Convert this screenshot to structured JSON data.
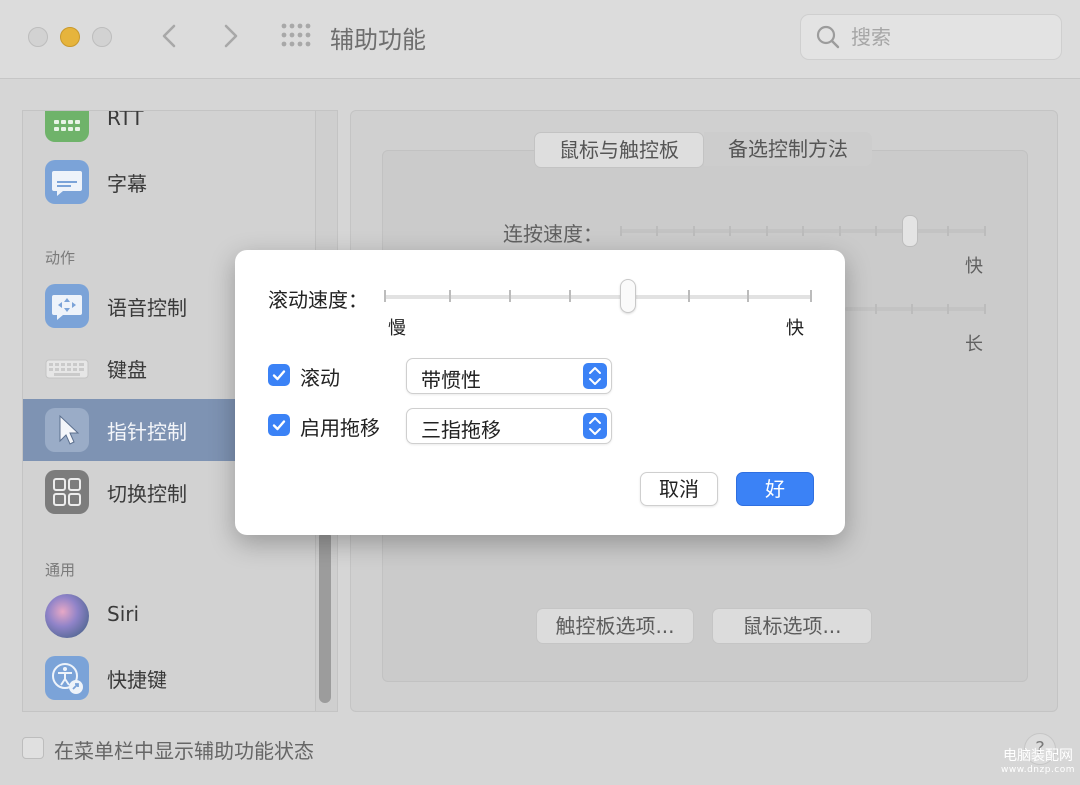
{
  "window": {
    "title": "辅助功能"
  },
  "search": {
    "placeholder": "搜索"
  },
  "sidebar": {
    "items": [
      {
        "label": "RTT",
        "icon": "keyboard-icon"
      },
      {
        "label": "字幕",
        "icon": "captions-icon"
      },
      {
        "label": "语音控制",
        "icon": "voice-control-icon"
      },
      {
        "label": "键盘",
        "icon": "keyboard-icon"
      },
      {
        "label": "指针控制",
        "icon": "pointer-icon"
      },
      {
        "label": "切换控制",
        "icon": "switch-control-icon"
      },
      {
        "label": "Siri",
        "icon": "siri-icon"
      },
      {
        "label": "快捷键",
        "icon": "accessibility-shortcut-icon"
      }
    ],
    "sections": {
      "actions": "动作",
      "general": "通用"
    },
    "selected": "指针控制"
  },
  "main": {
    "tabs": [
      {
        "label": "鼠标与触控板"
      },
      {
        "label": "备选控制方法"
      }
    ],
    "double_click_label": "连按速度：",
    "fast_label": "快",
    "long_label": "长",
    "trackpad_options": "触控板选项...",
    "mouse_options": "鼠标选项..."
  },
  "footer": {
    "show_status": "在菜单栏中显示辅助功能状态",
    "help": "?"
  },
  "dialog": {
    "scroll_speed_label": "滚动速度：",
    "scroll_speed_value": 0.57,
    "slow_label": "慢",
    "fast_label": "快",
    "scrolling": {
      "label": "滚动",
      "checked": true,
      "value": "带惯性"
    },
    "dragging": {
      "label": "启用拖移",
      "checked": true,
      "value": "三指拖移"
    },
    "cancel_label": "取消",
    "ok_label": "好"
  },
  "watermark": {
    "line1": "电脑装配网",
    "line2": "www.dnzp.com"
  },
  "colors": {
    "accent": "#3b82f6",
    "selected_row": "#7e93b3"
  }
}
